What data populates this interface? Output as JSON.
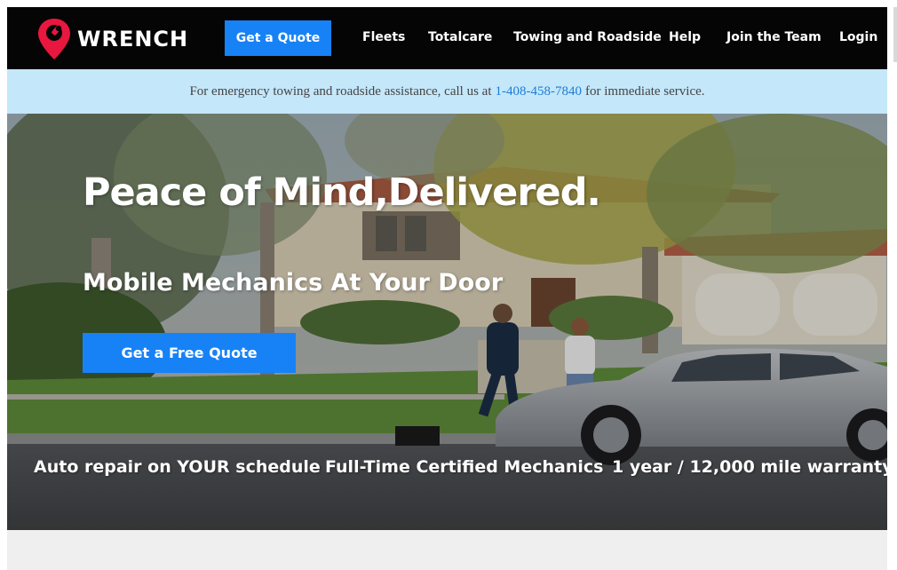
{
  "nav": {
    "logo_text": "WRENCH",
    "quote_label": "Get a Quote",
    "links": [
      "Fleets",
      "Totalcare",
      "Towing and Roadside",
      "Help",
      "Join the Team",
      "Login"
    ]
  },
  "banner": {
    "text_before": "For emergency towing and roadside assistance, call us at",
    "phone": "1-408-458-7840",
    "text_after": "for immediate service."
  },
  "hero": {
    "title": "Peace of Mind,Delivered.",
    "subtitle": "Mobile Mechanics At Your Door",
    "cta_label": "Get a Free Quote",
    "features": [
      "Auto repair on YOUR schedule",
      "Full-Time Certified Mechanics",
      "1 year / 12,000 mile warranty"
    ]
  },
  "colors": {
    "nav_bg": "#050505",
    "accent_blue": "#1782f6",
    "banner_bg": "#c4e7fa",
    "link_blue": "#1e7dd6",
    "logo_red": "#e8173f"
  }
}
